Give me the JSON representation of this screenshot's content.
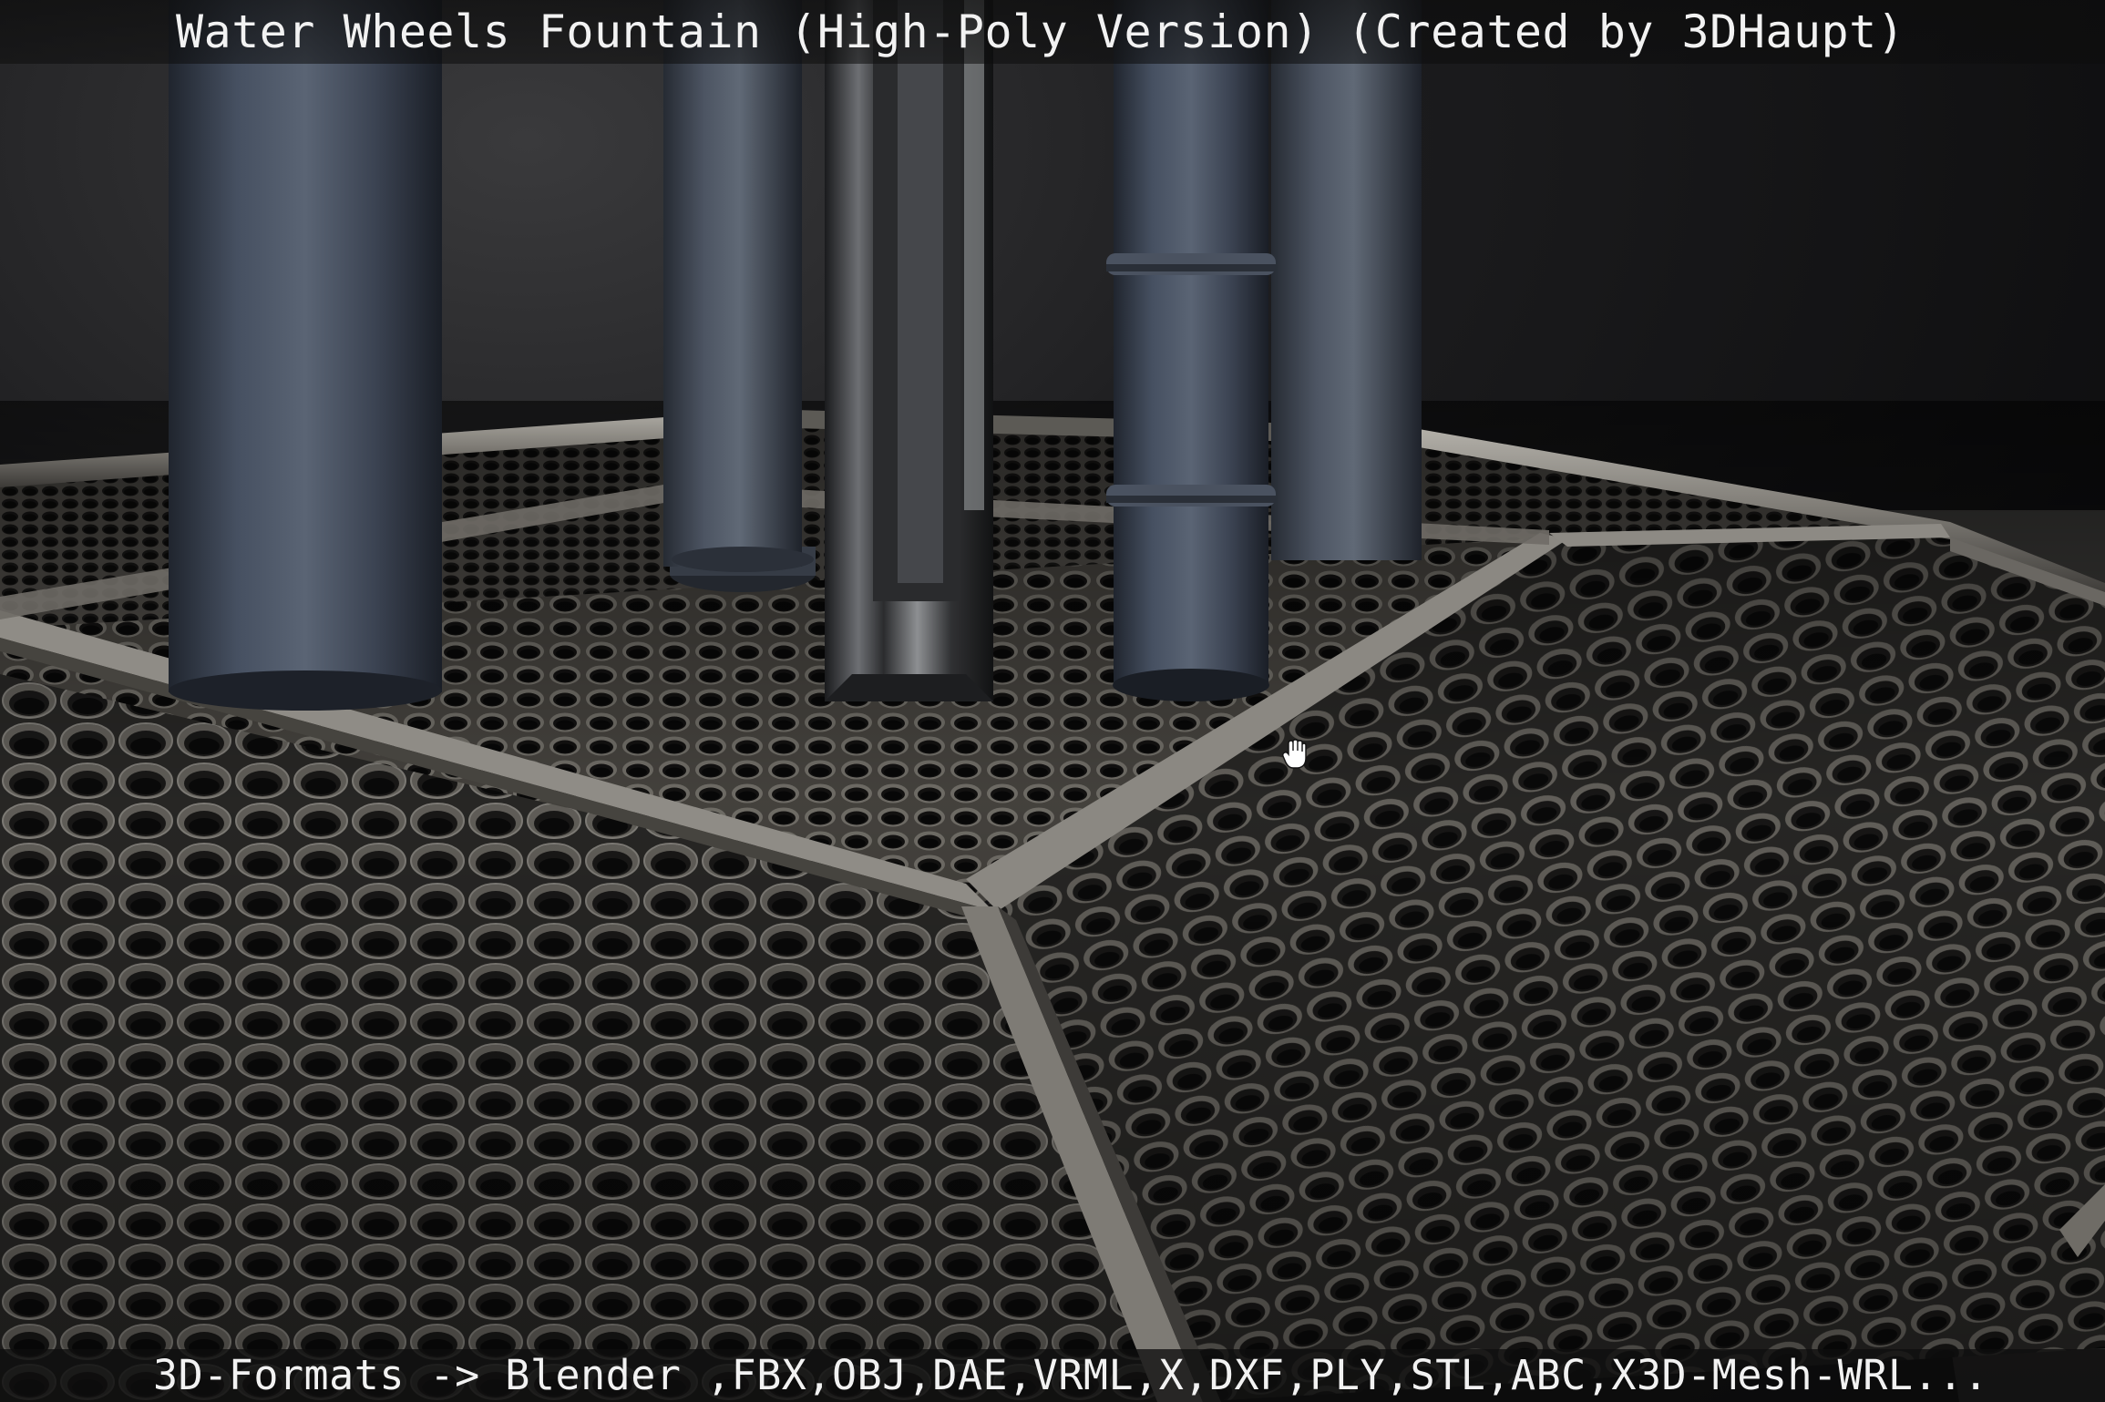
{
  "viewer": {
    "title": "Water Wheels Fountain (High-Poly Version) (Created by 3DHaupt)",
    "footer": "3D-Formats -> Blender ,FBX,OBJ,DAE,VRML,X,DXF,PLY,STL,ABC,X3D-Mesh-WRL..."
  },
  "scene": {
    "background_color": "#0b0b0c",
    "grate_color": "#3a3936",
    "rim_color": "#8e8c86",
    "pillar_color": "#3a4150"
  },
  "cursor": {
    "icon": "hand-cursor-icon"
  }
}
